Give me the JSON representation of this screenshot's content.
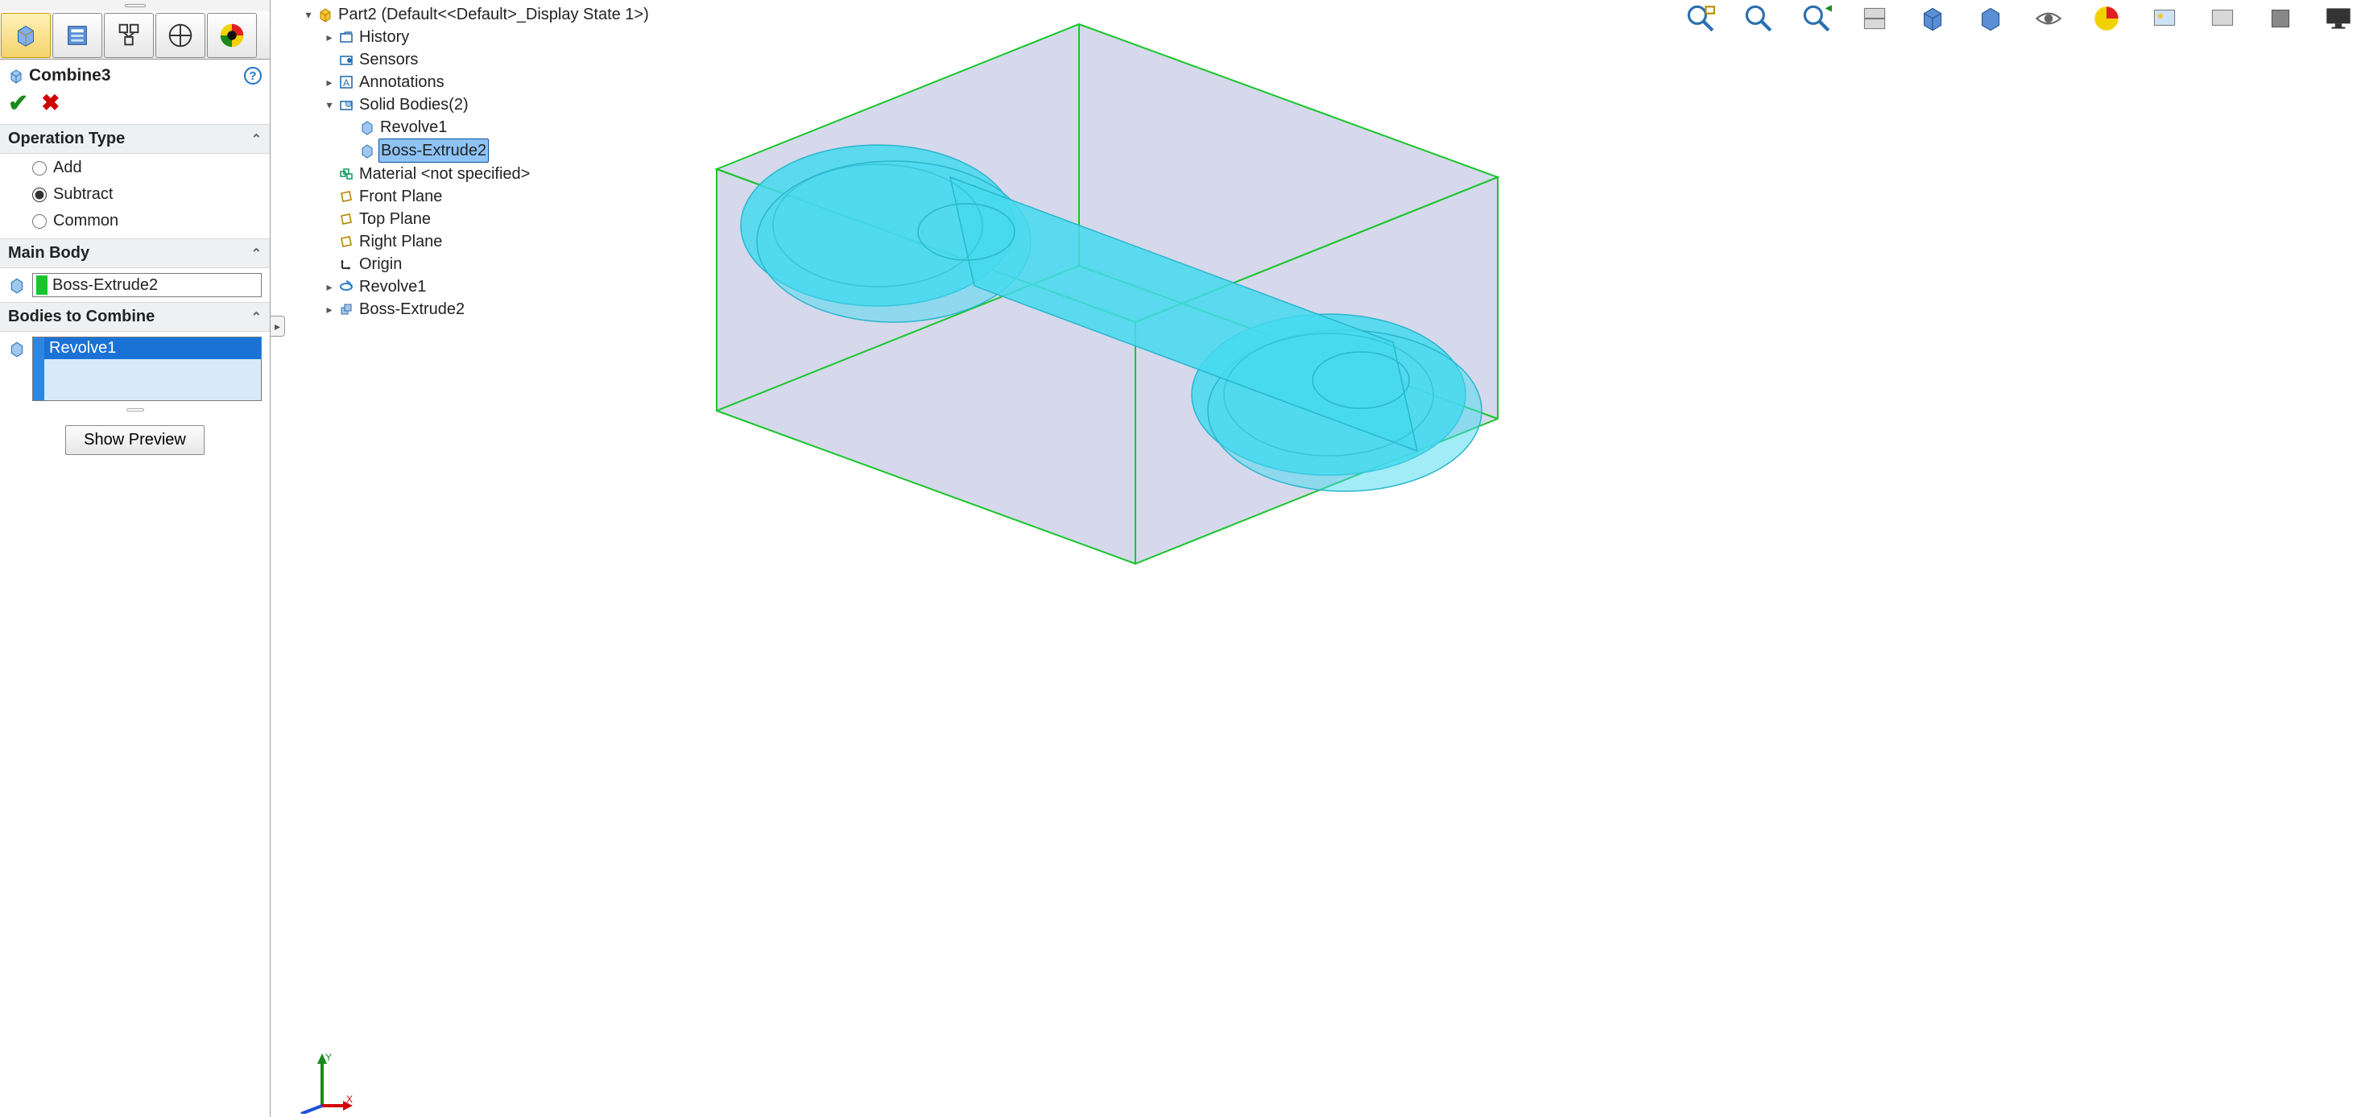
{
  "panel": {
    "feature_name": "Combine3",
    "operation_type_header": "Operation Type",
    "op_add": "Add",
    "op_subtract": "Subtract",
    "op_common": "Common",
    "main_body_header": "Main Body",
    "main_body_value": "Boss-Extrude2",
    "bodies_header": "Bodies to Combine",
    "bodies_item0": "Revolve1",
    "show_preview": "Show Preview"
  },
  "tree": {
    "root": "Part2  (Default<<Default>_Display State 1>)",
    "history": "History",
    "sensors": "Sensors",
    "annotations": "Annotations",
    "solid_bodies": "Solid Bodies(2)",
    "sb_revolve": "Revolve1",
    "sb_extrude": "Boss-Extrude2",
    "material": "Material <not specified>",
    "front": "Front Plane",
    "top": "Top Plane",
    "right": "Right Plane",
    "origin": "Origin",
    "revolve": "Revolve1",
    "extrude": "Boss-Extrude2"
  },
  "triad": {
    "x": "X",
    "y": "Y"
  }
}
